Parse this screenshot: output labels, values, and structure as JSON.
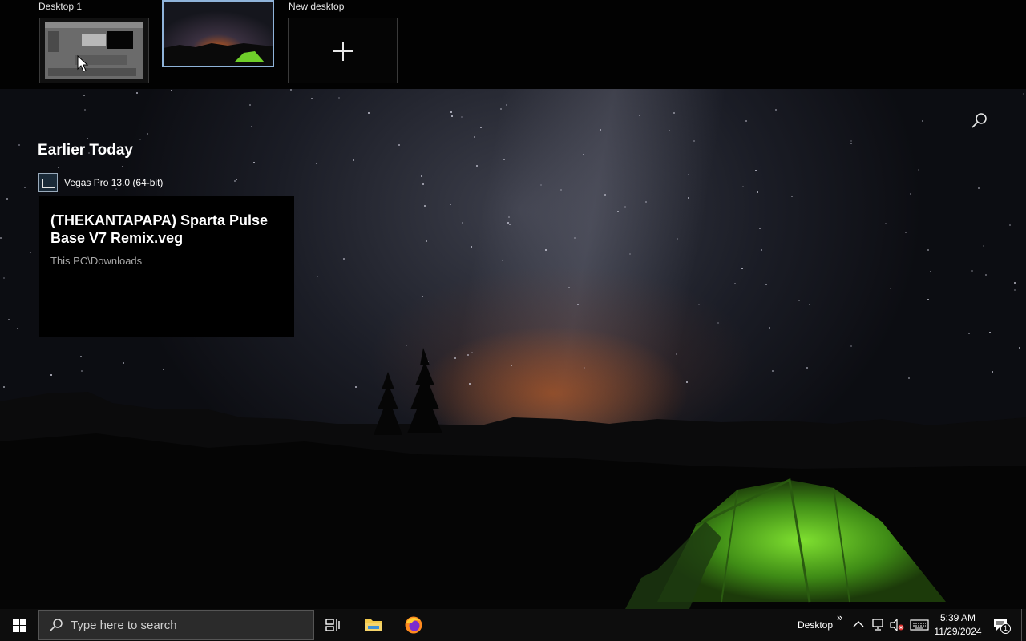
{
  "desktops": {
    "items": [
      {
        "label": "Desktop 1"
      },
      {
        "label": ""
      }
    ],
    "new_desktop_label": "New desktop"
  },
  "timeline": {
    "section_title": "Earlier Today",
    "activities": [
      {
        "app_name": "Vegas Pro 13.0 (64-bit)",
        "app_icon": "vegas-film-icon",
        "title": "(THEKANTAPAPA) Sparta Pulse Base V7 Remix.veg",
        "path": "This PC\\Downloads"
      }
    ]
  },
  "taskbar": {
    "search_placeholder": "Type here to search",
    "pinned": [
      "task-view-icon",
      "file-explorer-icon",
      "firefox-icon"
    ],
    "desktop_toolbar_label": "Desktop",
    "overflow_chevron": "»",
    "clock_time": "5:39 AM",
    "clock_date": "11/29/2024",
    "notification_count": "1"
  },
  "colors": {
    "active_desktop_border": "#8fb3d9",
    "taskbar_bg": "#0d0d0d",
    "tent_green": "#6fcf2a",
    "horizon_glow": "#cd5f1e"
  }
}
